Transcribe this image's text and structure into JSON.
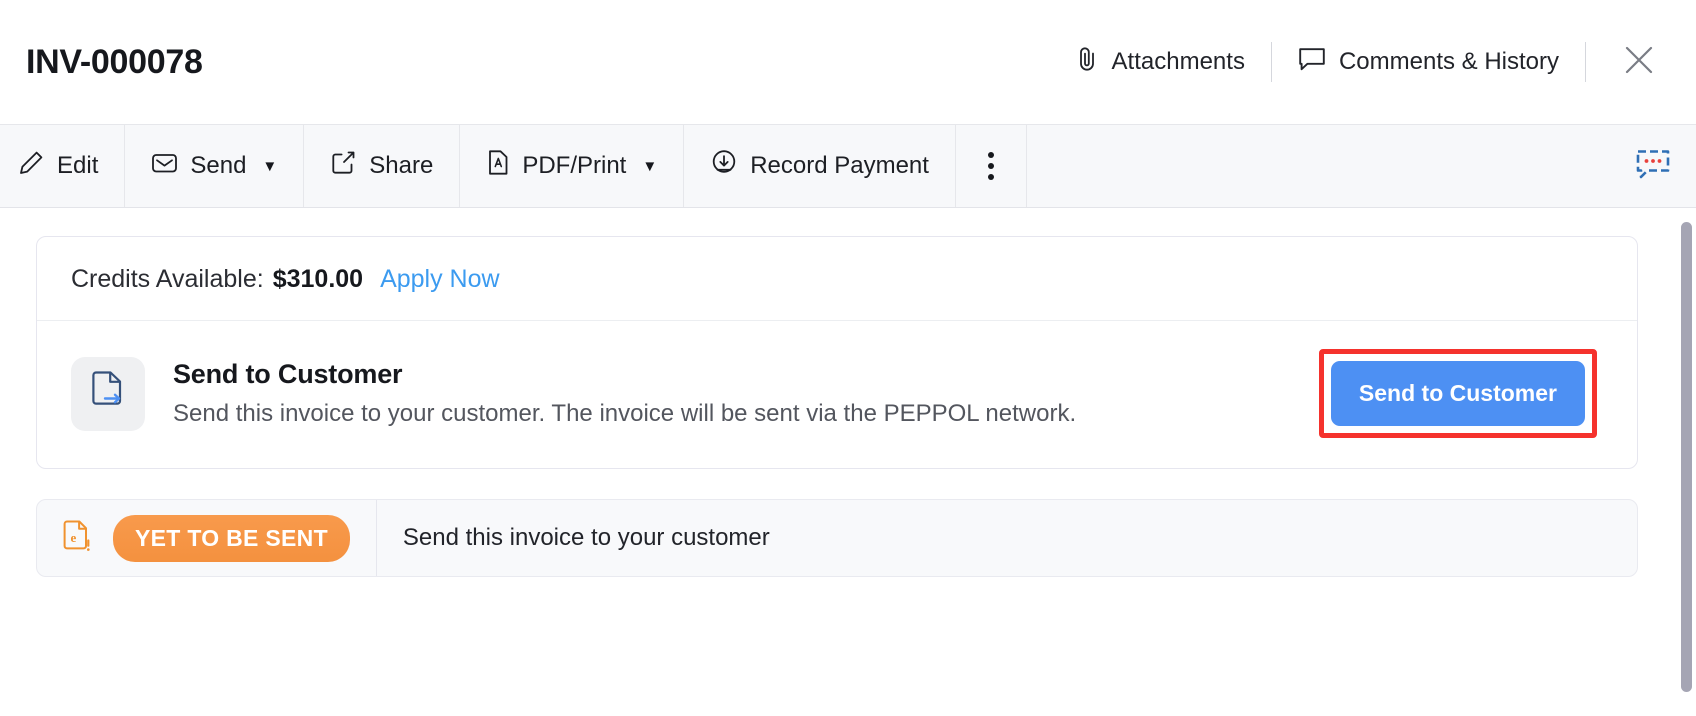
{
  "header": {
    "title": "INV-000078",
    "actions": [
      {
        "label": "Attachments",
        "icon": "paperclip-icon"
      },
      {
        "label": "Comments & History",
        "icon": "comment-bubble-icon"
      }
    ],
    "close_icon": "close-icon"
  },
  "toolbar": {
    "buttons": [
      {
        "label": "Edit",
        "icon": "pencil-icon",
        "caret": ""
      },
      {
        "label": "Send",
        "icon": "envelope-icon",
        "caret": "▼"
      },
      {
        "label": "Share",
        "icon": "share-icon",
        "caret": ""
      },
      {
        "label": "PDF/Print",
        "icon": "pdf-file-icon",
        "caret": "▼"
      },
      {
        "label": "Record Payment",
        "icon": "download-circle-icon",
        "caret": ""
      }
    ],
    "overflow_icon": "kebab-menu-icon",
    "annotation_icon": "chat-annotation-icon"
  },
  "credits": {
    "label": "Credits Available:",
    "amount": "$310.00",
    "link": "Apply Now"
  },
  "send_section": {
    "icon": "document-send-icon",
    "title": "Send to Customer",
    "description": "Send this invoice to your customer. The invoice will be sent via the PEPPOL network.",
    "button_label": "Send to Customer"
  },
  "status_strip": {
    "icon": "einvoice-alert-icon",
    "badge": "YET TO BE SENT",
    "message": "Send this invoice to your customer"
  },
  "colors": {
    "accent_blue": "#4d90f3",
    "link_blue": "#3c9bf0",
    "highlight_red": "#f5322d",
    "status_orange": "#f4913f",
    "toolbar_bg": "#f7f8fa"
  }
}
